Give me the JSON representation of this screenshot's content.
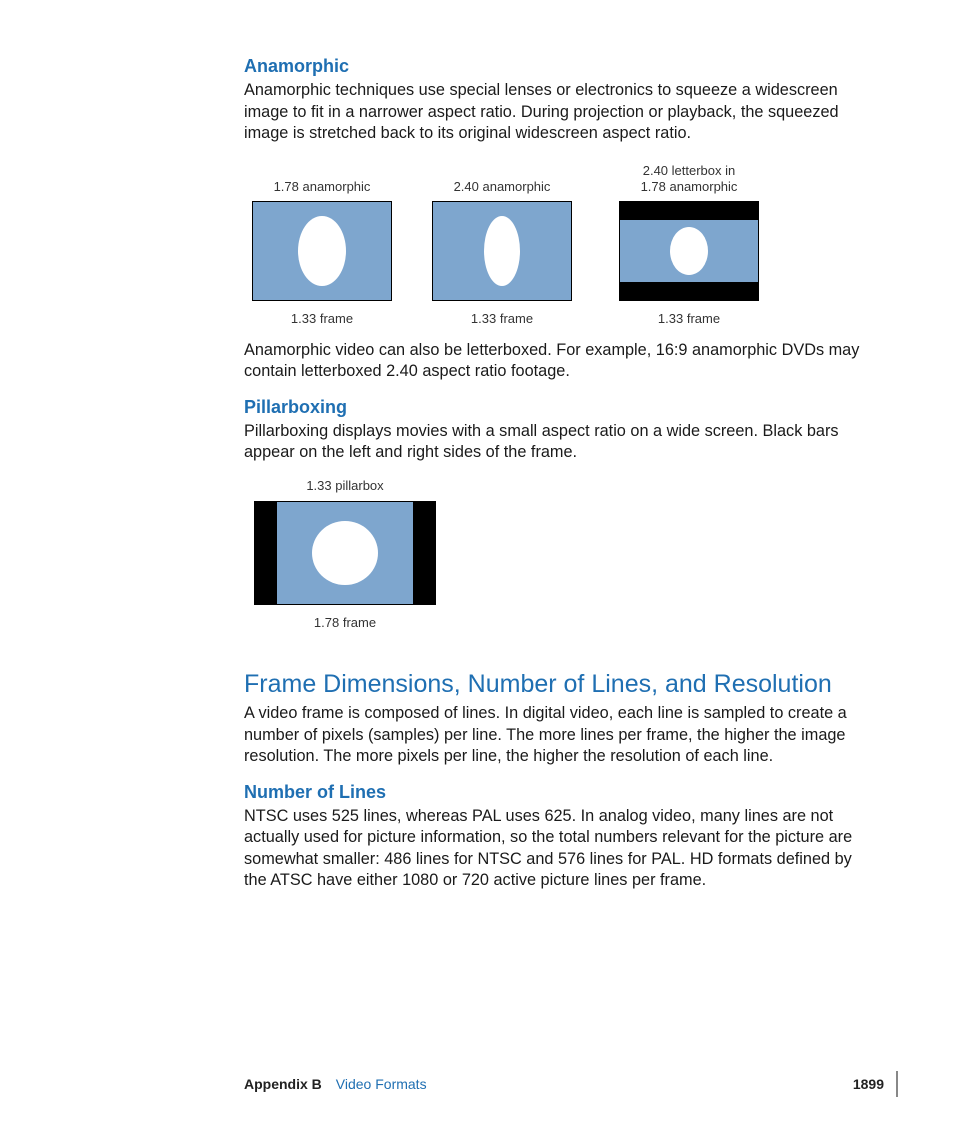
{
  "sections": {
    "anamorphic": {
      "heading": "Anamorphic",
      "p1": "Anamorphic techniques use special lenses or electronics to squeeze a widescreen image to fit in a narrower aspect ratio. During projection or playback, the squeezed image is stretched back to its original widescreen aspect ratio.",
      "p2": "Anamorphic video can also be letterboxed. For example, 16:9 anamorphic DVDs may contain letterboxed 2.40 aspect ratio footage."
    },
    "pillarboxing": {
      "heading": "Pillarboxing",
      "p1": "Pillarboxing displays movies with a small aspect ratio on a wide screen. Black bars appear on the left and right sides of the frame."
    },
    "frame_dims": {
      "heading": "Frame Dimensions, Number of Lines, and Resolution",
      "p1": "A video frame is composed of lines. In digital video, each line is sampled to create a number of pixels (samples) per line. The more lines per frame, the higher the image resolution. The more pixels per line, the higher the resolution of each line."
    },
    "num_lines": {
      "heading": "Number of Lines",
      "p1": "NTSC uses 525 lines, whereas PAL uses 625. In analog video, many lines are not actually used for picture information, so the total numbers relevant for the picture are somewhat smaller: 486 lines for NTSC and 576 lines for PAL. HD formats defined by the ATSC have either 1080 or 720 active picture lines per frame."
    }
  },
  "figures": {
    "anamorphic_row": [
      {
        "top": "1.78 anamorphic",
        "bottom": "1.33 frame"
      },
      {
        "top": "2.40 anamorphic",
        "bottom": "1.33 frame"
      },
      {
        "top": "2.40 letterbox in\n1.78 anamorphic",
        "bottom": "1.33 frame"
      }
    ],
    "pillarbox": {
      "top": "1.33 pillarbox",
      "bottom": "1.78 frame"
    }
  },
  "footer": {
    "appendix": "Appendix B",
    "chapter": "Video Formats",
    "page": "1899"
  }
}
